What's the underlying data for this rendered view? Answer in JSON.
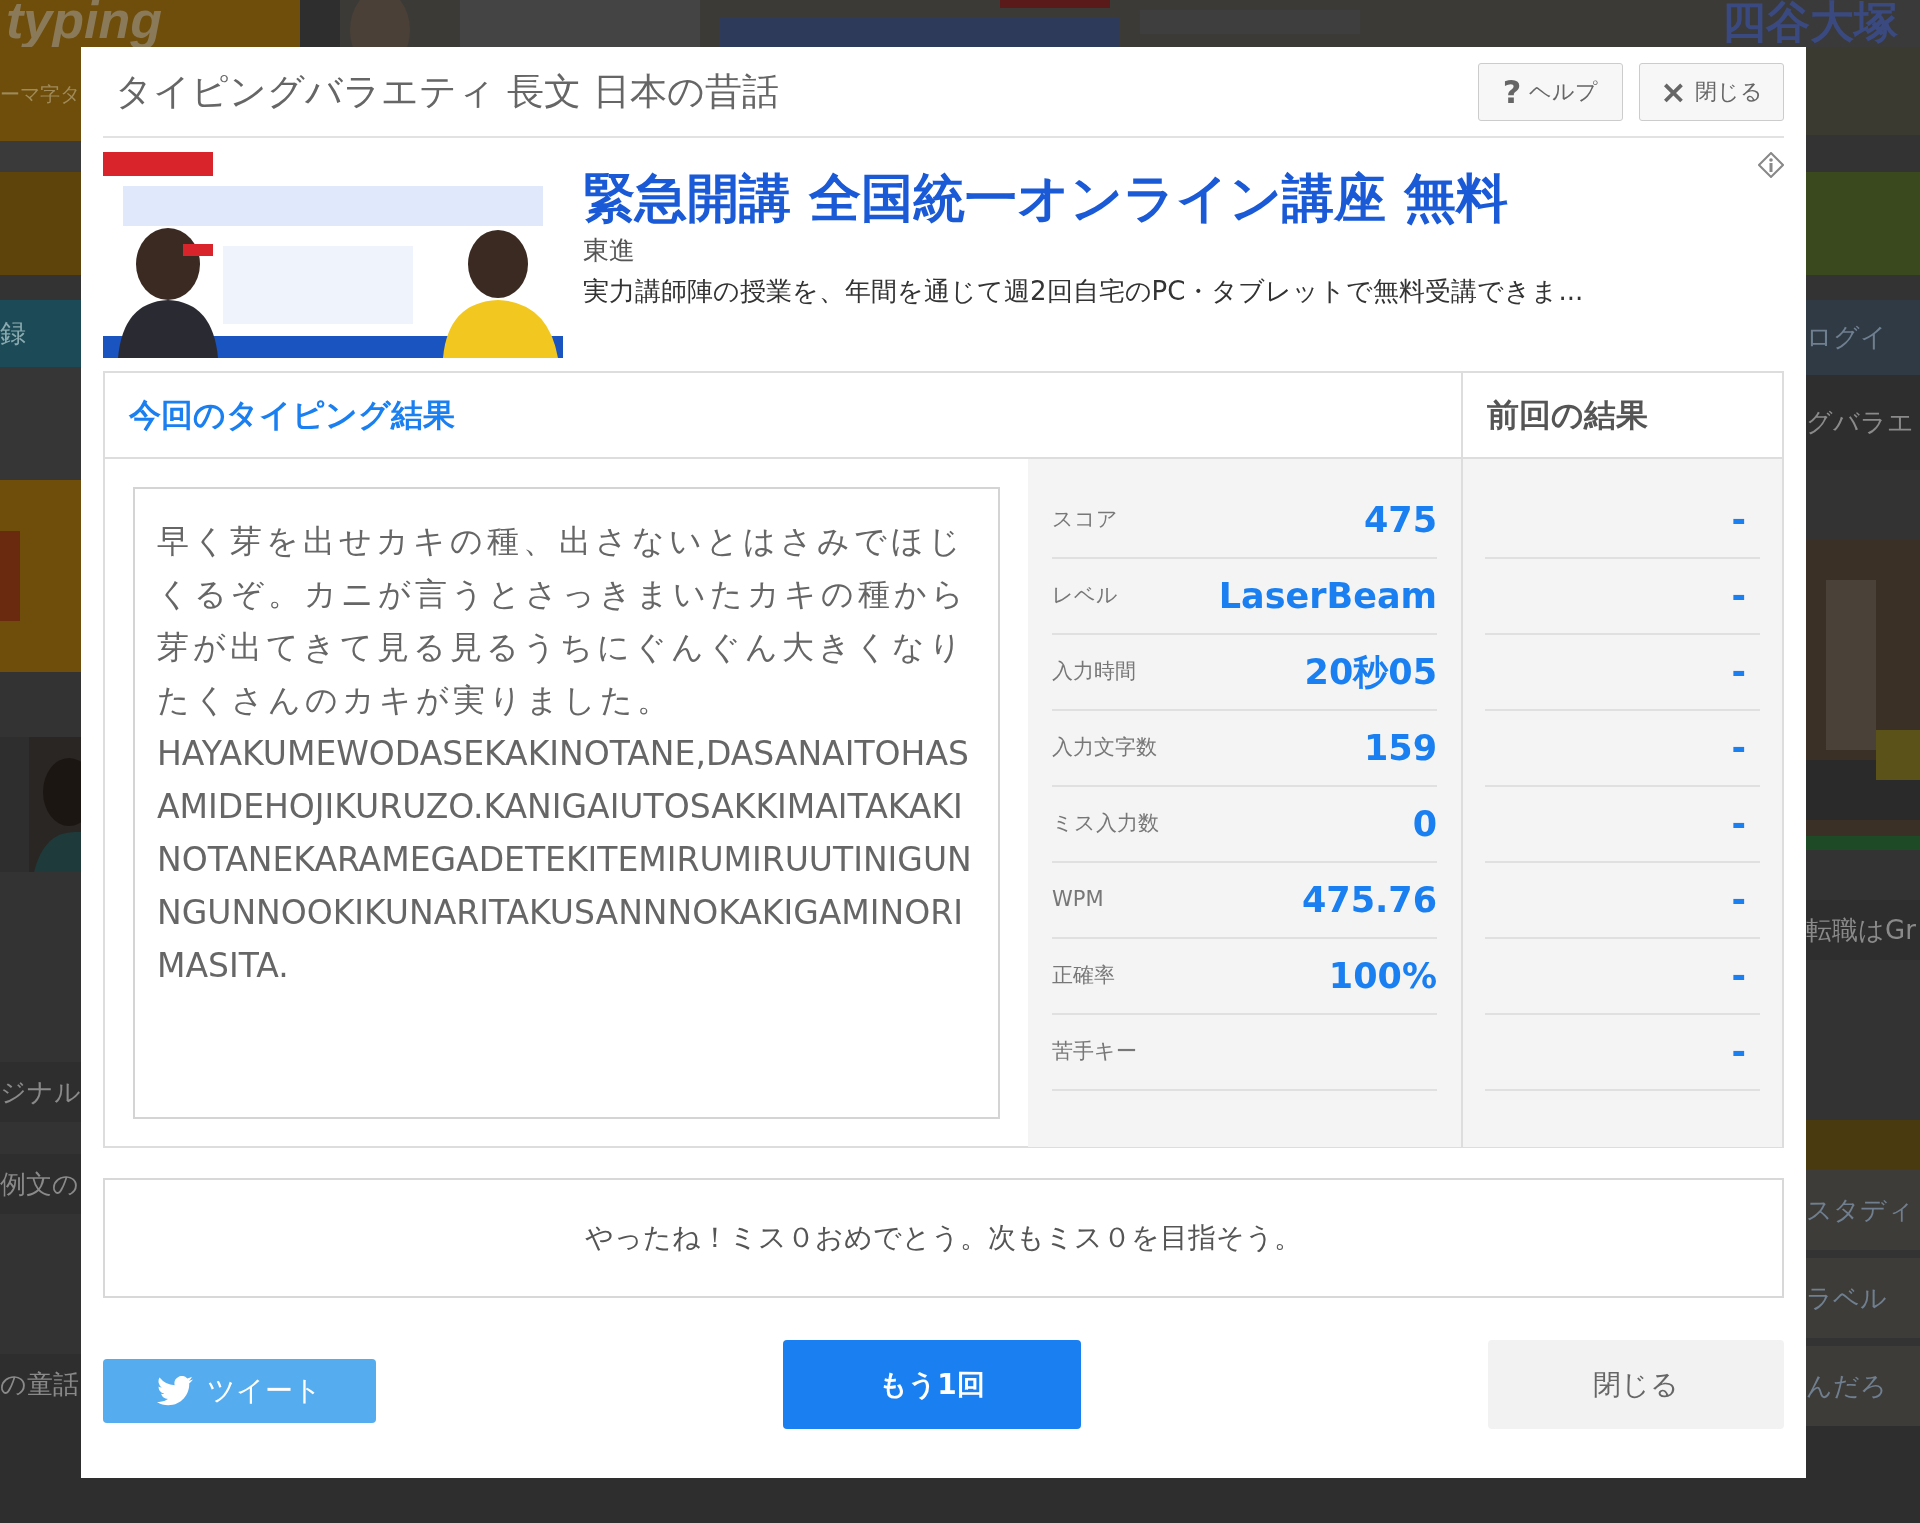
{
  "backdrop": {
    "logo": "typing",
    "logo_sub": "ーマ字タ",
    "banner_text": "四谷大塚",
    "left": [
      {
        "kind": "teal",
        "text": "録"
      },
      {
        "kind": "text",
        "text": "ジナル"
      },
      {
        "kind": "text",
        "text": "例文の"
      },
      {
        "kind": "text",
        "text": "の童話"
      }
    ],
    "right": [
      {
        "kind": "bar",
        "text": "ログイ"
      },
      {
        "kind": "text",
        "text": "グバラエ"
      },
      {
        "kind": "text",
        "text": "転職はGr"
      },
      {
        "kind": "bar",
        "text": "スタディ"
      },
      {
        "kind": "bar",
        "text": "ラベル"
      },
      {
        "kind": "bar",
        "text": "んだろ"
      }
    ]
  },
  "dialog": {
    "title": "タイピングバラエティ 長文 日本の昔話",
    "buttons": [
      {
        "icon": "?",
        "label": "ヘルプ"
      },
      {
        "icon": "×",
        "label": "閉じる"
      }
    ]
  },
  "ad": {
    "headline": "緊急開講 全国統一オンライン講座 無料",
    "advertiser": "東進",
    "description": "実力講師陣の授業を、年間を通じて週2回自宅のPC・タブレットで無料受講できま..."
  },
  "results": {
    "current_title": "今回のタイピング結果",
    "previous_title": "前回の結果",
    "passage": {
      "kana": "早く芽を出せカキの種、出さないとはさみでほじくるぞ。カニが言うとさっきまいたカキの種から芽が出てきて見る見るうちにぐんぐん大きくなりたくさんのカキが実りました。",
      "romaji": "HAYAKUMEWODASEKAKINOTANE,DASANAITOHASAMIDEHOJIKURUZO.KANIGAIUTOSAKKIMAITAKAKINOTANEKARAMEGADETEKITEMIRUMIRUUTINIGUNNGUNNOOKIKUNARITAKUSANNNOKAKIGAMINORIMASITA."
    },
    "stats": [
      {
        "label": "スコア",
        "value": "475",
        "previous": "-"
      },
      {
        "label": "レベル",
        "value": "LaserBeam",
        "previous": "-"
      },
      {
        "label": "入力時間",
        "value": "20秒05",
        "previous": "-"
      },
      {
        "label": "入力文字数",
        "value": "159",
        "previous": "-"
      },
      {
        "label": "ミス入力数",
        "value": "0",
        "previous": "-"
      },
      {
        "label": "WPM",
        "value": "475.76",
        "previous": "-"
      },
      {
        "label": "正確率",
        "value": "100%",
        "previous": "-"
      },
      {
        "label": "苦手キー",
        "previous": "-"
      }
    ]
  },
  "message": "やったね！ミス０おめでとう。次もミス０を目指そう。",
  "footer_buttons": [
    {
      "kind": "tweet",
      "label": "ツイート"
    },
    {
      "kind": "primary",
      "label": "もう1回"
    },
    {
      "kind": "secondary",
      "label": "閉じる"
    }
  ]
}
